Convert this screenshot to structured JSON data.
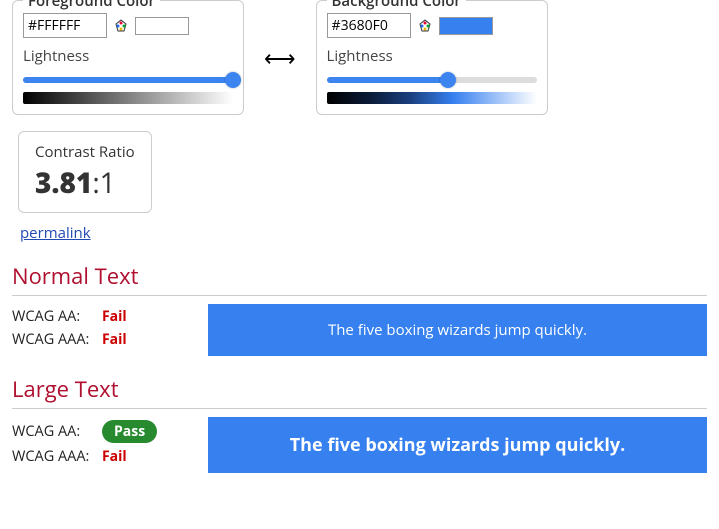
{
  "foreground": {
    "heading": "Foreground Color",
    "value": "#FFFFFF",
    "swatch": "#FFFFFF",
    "lightness_label": "Lightness",
    "slider_percent": 100,
    "gradient_css": "linear-gradient(to right, #000000, #808080, #ffffff)"
  },
  "background": {
    "heading": "Background Color",
    "value": "#3680F0",
    "swatch": "#3680F0",
    "lightness_label": "Lightness",
    "slider_percent": 58,
    "gradient_css": "linear-gradient(to right, #000000, #0a1a36, #1b4080, #3680F0, #9bc0f8, #ffffff)"
  },
  "arrow": "⟷",
  "contrast": {
    "title": "Contrast Ratio",
    "value": "3.81",
    "suffix": ":1",
    "permalink": "permalink"
  },
  "normal": {
    "heading": "Normal Text",
    "aa_label": "WCAG AA:",
    "aa_result": "Fail",
    "aa_pass": false,
    "aaa_label": "WCAG AAA:",
    "aaa_result": "Fail",
    "aaa_pass": false,
    "sample": "The five boxing wizards jump quickly."
  },
  "large": {
    "heading": "Large Text",
    "aa_label": "WCAG AA:",
    "aa_result": "Pass",
    "aa_pass": true,
    "aaa_label": "WCAG AAA:",
    "aaa_result": "Fail",
    "aaa_pass": false,
    "sample": "The five boxing wizards jump quickly."
  }
}
